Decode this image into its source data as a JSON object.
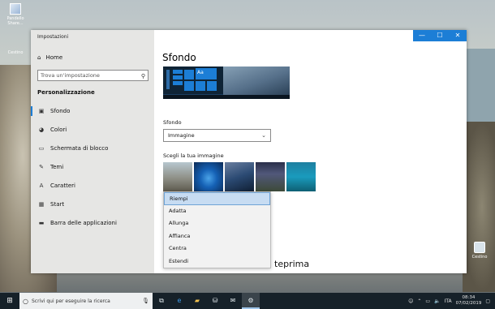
{
  "desktop": {
    "shortcut_label": "Pandello\nShare...",
    "recycle_top_label": "Cestino",
    "recycle_label": "Cestino"
  },
  "window": {
    "title": "Impostazioni",
    "controls": {
      "minimize": "—",
      "maximize": "☐",
      "close": "✕"
    }
  },
  "sidebar": {
    "home_label": "Home",
    "search_placeholder": "Trova un'impostazione",
    "section_title": "Personalizzazione",
    "items": [
      {
        "label": "Sfondo",
        "icon": "picture-icon",
        "active": true
      },
      {
        "label": "Colori",
        "icon": "palette-icon",
        "active": false
      },
      {
        "label": "Schermata di blocco",
        "icon": "lock-screen-icon",
        "active": false
      },
      {
        "label": "Temi",
        "icon": "brush-icon",
        "active": false
      },
      {
        "label": "Caratteri",
        "icon": "font-icon",
        "active": false
      },
      {
        "label": "Start",
        "icon": "start-icon",
        "active": false
      },
      {
        "label": "Barra delle applicazioni",
        "icon": "taskbar-icon",
        "active": false
      }
    ]
  },
  "main": {
    "heading": "Sfondo",
    "preview_tile_text": "Aa",
    "background_label": "Sfondo",
    "background_value": "Immagine",
    "choose_image_label": "Scegli la tua immagine",
    "fit_options": [
      "Riempi",
      "Adatta",
      "Allunga",
      "Affianca",
      "Centra",
      "Estendi"
    ],
    "fit_selected": "Riempi",
    "partial_text": "teprima"
  },
  "taskbar": {
    "search_placeholder": "Scrivi qui per eseguire la ricerca",
    "apps": [
      "task-view-icon",
      "edge-icon",
      "file-explorer-icon",
      "store-icon",
      "mail-icon",
      "settings-icon"
    ],
    "language": "ITA",
    "time": "08:34",
    "date": "07/02/2019"
  },
  "colors": {
    "accent": "#1c7ed6",
    "taskbar": "#162129",
    "sidebar": "#e4e4e2"
  }
}
